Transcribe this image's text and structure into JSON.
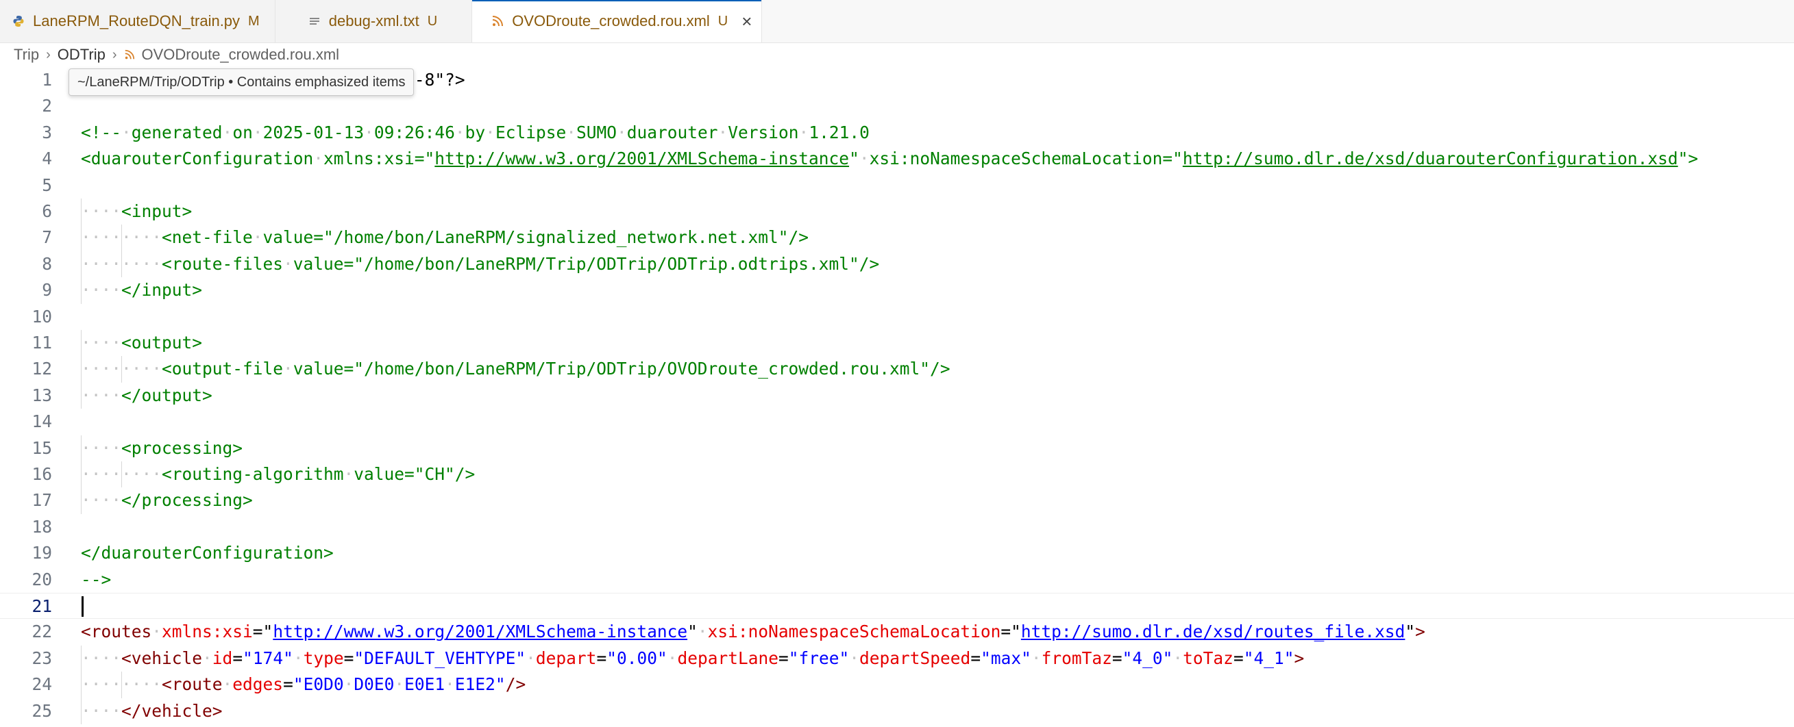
{
  "tabs": [
    {
      "label": "LaneRPM_RouteDQN_train.py",
      "badge": "M",
      "icon": "python-file-icon"
    },
    {
      "label": "debug-xml.txt",
      "badge": "U",
      "icon": "text-file-icon"
    },
    {
      "label": "OVODroute_crowded.rou.xml",
      "badge": "U",
      "icon": "xml-rss-file-icon",
      "active": true
    }
  ],
  "breadcrumb": [
    "Trip",
    "ODTrip",
    "OVODroute_crowded.rou.xml"
  ],
  "tooltip": "~/LaneRPM/Trip/ODTrip • Contains emphasized items",
  "colors": {
    "comment": "#008000",
    "tag": "#800000",
    "attribute": "#e50000",
    "value": "#0000ff",
    "accent": "#005fb8",
    "badge": "#8a5a0b"
  },
  "editor": {
    "active_line": 21,
    "lines": [
      {
        "n": "1",
        "indent": 0,
        "segs": [
          [
            "d",
            "<?xml version=\"1.0\" encoding=\"UTF-8\"?>"
          ]
        ]
      },
      {
        "n": "2",
        "indent": 0,
        "segs": []
      },
      {
        "n": "3",
        "indent": 0,
        "segs": [
          [
            "c",
            "<!-- generated on 2025-01-13 09:26:46 by Eclipse SUMO duarouter Version 1.21.0"
          ]
        ]
      },
      {
        "n": "4",
        "indent": 0,
        "segs": [
          [
            "c",
            "<duarouterConfiguration xmlns:xsi=\""
          ],
          [
            "cu",
            "http://www.w3.org/2001/XMLSchema-instance"
          ],
          [
            "c",
            "\" xsi:noNamespaceSchemaLocation=\""
          ],
          [
            "cu",
            "http://sumo.dlr.de/xsd/duarouterConfiguration.xsd"
          ],
          [
            "c",
            "\">"
          ]
        ]
      },
      {
        "n": "5",
        "indent": 0,
        "segs": []
      },
      {
        "n": "6",
        "indent": 1,
        "segs": [
          [
            "c",
            "<input>"
          ]
        ]
      },
      {
        "n": "7",
        "indent": 2,
        "segs": [
          [
            "c",
            "<net-file value=\"/home/bon/LaneRPM/signalized_network.net.xml\"/>"
          ]
        ]
      },
      {
        "n": "8",
        "indent": 2,
        "segs": [
          [
            "c",
            "<route-files value=\"/home/bon/LaneRPM/Trip/ODTrip/ODTrip.odtrips.xml\"/>"
          ]
        ]
      },
      {
        "n": "9",
        "indent": 1,
        "segs": [
          [
            "c",
            "</input>"
          ]
        ]
      },
      {
        "n": "10",
        "indent": 0,
        "segs": []
      },
      {
        "n": "11",
        "indent": 1,
        "segs": [
          [
            "c",
            "<output>"
          ]
        ]
      },
      {
        "n": "12",
        "indent": 2,
        "segs": [
          [
            "c",
            "<output-file value=\"/home/bon/LaneRPM/Trip/ODTrip/OVODroute_crowded.rou.xml\"/>"
          ]
        ]
      },
      {
        "n": "13",
        "indent": 1,
        "segs": [
          [
            "c",
            "</output>"
          ]
        ]
      },
      {
        "n": "14",
        "indent": 0,
        "segs": []
      },
      {
        "n": "15",
        "indent": 1,
        "segs": [
          [
            "c",
            "<processing>"
          ]
        ]
      },
      {
        "n": "16",
        "indent": 2,
        "segs": [
          [
            "c",
            "<routing-algorithm value=\"CH\"/>"
          ]
        ]
      },
      {
        "n": "17",
        "indent": 1,
        "segs": [
          [
            "c",
            "</processing>"
          ]
        ]
      },
      {
        "n": "18",
        "indent": 0,
        "segs": []
      },
      {
        "n": "19",
        "indent": 0,
        "segs": [
          [
            "c",
            "</duarouterConfiguration>"
          ]
        ]
      },
      {
        "n": "20",
        "indent": 0,
        "segs": [
          [
            "c",
            "-->"
          ]
        ]
      },
      {
        "n": "21",
        "indent": 0,
        "segs": []
      },
      {
        "n": "22",
        "indent": 0,
        "segs": [
          [
            "t",
            "<routes"
          ],
          [
            "a",
            " xmlns:xsi"
          ],
          [
            "d",
            "=\""
          ],
          [
            "u",
            "http://www.w3.org/2001/XMLSchema-instance"
          ],
          [
            "d",
            "\""
          ],
          [
            "a",
            " xsi:noNamespaceSchemaLocation"
          ],
          [
            "d",
            "=\""
          ],
          [
            "u",
            "http://sumo.dlr.de/xsd/routes_file.xsd"
          ],
          [
            "d",
            "\""
          ],
          [
            "t",
            ">"
          ]
        ]
      },
      {
        "n": "23",
        "indent": 1,
        "segs": [
          [
            "t",
            "<vehicle"
          ],
          [
            "a",
            " id"
          ],
          [
            "d",
            "="
          ],
          [
            "v",
            "\"174\""
          ],
          [
            "a",
            " type"
          ],
          [
            "d",
            "="
          ],
          [
            "v",
            "\"DEFAULT_VEHTYPE\""
          ],
          [
            "a",
            " depart"
          ],
          [
            "d",
            "="
          ],
          [
            "v",
            "\"0.00\""
          ],
          [
            "a",
            " departLane"
          ],
          [
            "d",
            "="
          ],
          [
            "v",
            "\"free\""
          ],
          [
            "a",
            " departSpeed"
          ],
          [
            "d",
            "="
          ],
          [
            "v",
            "\"max\""
          ],
          [
            "a",
            " fromTaz"
          ],
          [
            "d",
            "="
          ],
          [
            "v",
            "\"4_0\""
          ],
          [
            "a",
            " toTaz"
          ],
          [
            "d",
            "="
          ],
          [
            "v",
            "\"4_1\""
          ],
          [
            "t",
            ">"
          ]
        ]
      },
      {
        "n": "24",
        "indent": 2,
        "segs": [
          [
            "t",
            "<route"
          ],
          [
            "a",
            " edges"
          ],
          [
            "d",
            "="
          ],
          [
            "v",
            "\"E0D0 D0E0 E0E1 E1E2\""
          ],
          [
            "t",
            "/>"
          ]
        ]
      },
      {
        "n": "25",
        "indent": 1,
        "segs": [
          [
            "t",
            "</vehicle>"
          ]
        ]
      }
    ]
  }
}
